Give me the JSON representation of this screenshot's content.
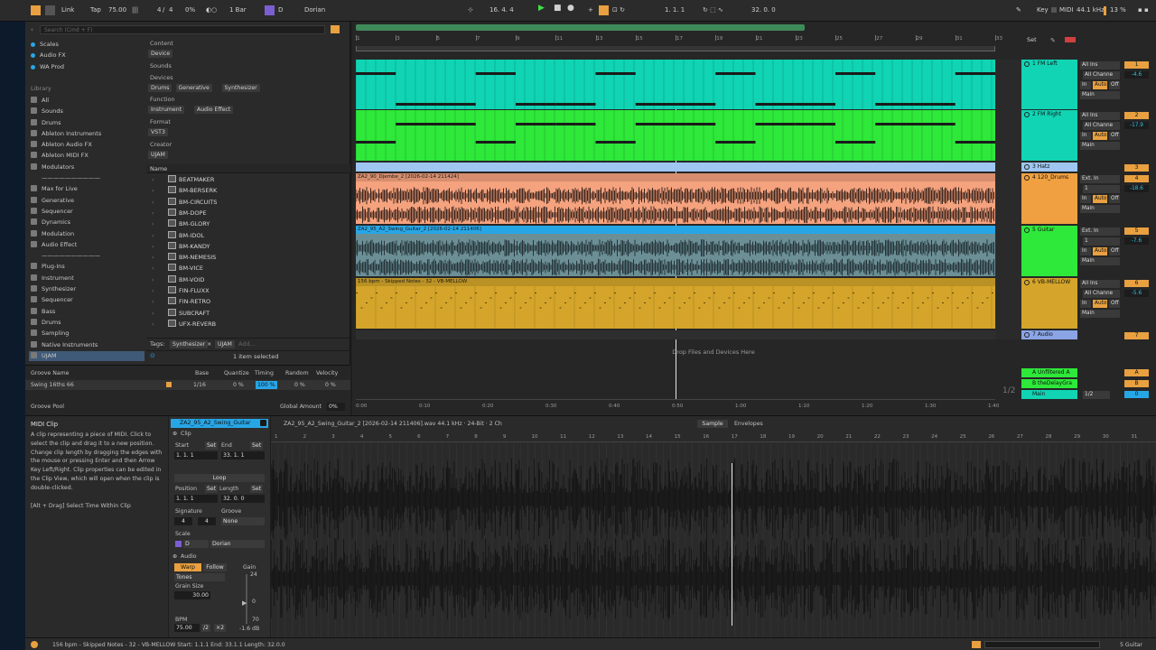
{
  "control": {
    "link": "Link",
    "tap": "Tap",
    "tempo": "75.00",
    "sig_num": "4",
    "sig_den": "4",
    "cpu_pct": "0%",
    "quant": "1 Bar",
    "root": "D",
    "scale": "Dorian",
    "arr_pos": "16.   4.   4",
    "loop_start": "1.   1.   1",
    "loop_len": "32.   0.   0",
    "key_label": "Key",
    "midi_label": "MIDI",
    "sample_rate": "44.1 kHz",
    "cpu": "13 %"
  },
  "browser": {
    "search_placeholder": "Search (Cmd + F)",
    "collections": [
      "Scales",
      "Audio FX",
      "WA Prod"
    ],
    "library_title": "Library",
    "library": [
      "All",
      "Sounds",
      "Drums",
      "Ableton Instruments",
      "Ableton Audio FX",
      "Ableton MIDI FX",
      "Modulators"
    ],
    "sep1": "——————————",
    "library2": [
      "Max for Live",
      "Generative",
      "Sequencer",
      "Dynamics",
      "Modulation",
      "Audio Effect"
    ],
    "sep2": "——————————",
    "library3": [
      "Plug-Ins",
      "Instrument",
      "Synthesizer",
      "Sequencer",
      "Bass",
      "Drums",
      "Sampling",
      "Native Instruments",
      "UJAM"
    ],
    "filters": {
      "content": "Content",
      "content_v": "Device",
      "sounds": "Sounds",
      "devices": "Devices",
      "devices_v": [
        "Drums",
        "Generative",
        "Synthesizer"
      ],
      "function": "Function",
      "function_v": [
        "Instrument",
        "Audio Effect"
      ],
      "format": "Format",
      "format_v": "VST3",
      "creator": "Creator",
      "creator_v": "UJAM"
    },
    "name_header": "Name",
    "presets": [
      "BEATMAKER",
      "BM-BERSERK",
      "BM-CIRCUITS",
      "BM-DOPE",
      "BM-GLORY",
      "BM-IDOL",
      "BM-KANDY",
      "BM-NEMESIS",
      "BM-VICE",
      "BM-VOID",
      "FIN-FLUXX",
      "FIN-RETRO",
      "SUBCRAFT",
      "UFX-REVERB"
    ],
    "tags_label": "Tags:",
    "tag1": "Synthesizer",
    "tag2": "UJAM",
    "tag_add": "Add...",
    "selected": "1 item selected"
  },
  "groove": {
    "h_name": "Groove Name",
    "h_base": "Base",
    "h_quant": "Quantize",
    "h_timing": "Timing",
    "h_random": "Random",
    "h_vel": "Velocity",
    "name": "Swing 16ths 66",
    "base": "1/16",
    "quant": "0 %",
    "timing": "100 %",
    "random": "0 %",
    "vel": "0 %",
    "pool": "Groove Pool",
    "global": "Global Amount",
    "global_v": "0%"
  },
  "ruler": [
    "1",
    "3",
    "5",
    "7",
    "9",
    "11",
    "13",
    "15",
    "17",
    "19",
    "21",
    "23",
    "25",
    "27",
    "29",
    "31",
    "33"
  ],
  "time_ruler": [
    "0:00",
    "0:10",
    "0:20",
    "0:30",
    "0:40",
    "0:50",
    "1:00",
    "1:10",
    "1:20",
    "1:30",
    "1:40"
  ],
  "clips": {
    "c4": "ZA2_90_Djembe_2 [2026-02-14 211424]",
    "c5": "ZA2_95_A2_Swing_Guitar_2 [2026-02-14 211406]",
    "c6": "156 bpm - Skipped Notes - 32 - VB-MELLOW"
  },
  "drop_hint": "Drop Files and Devices Here",
  "zoom": "1/2",
  "set_label": "Set",
  "tracks": [
    {
      "name": "1 FM Left",
      "num": "1",
      "in": "All Ins",
      "ch": "All Channe",
      "vol": "-4.6",
      "mon_in": "In",
      "mon_auto": "Auto",
      "mon_off": "Off",
      "out": "Main"
    },
    {
      "name": "2 FM Right",
      "num": "2",
      "in": "All Ins",
      "ch": "All Channe",
      "vol": "-17.9",
      "mon_in": "In",
      "mon_auto": "Auto",
      "mon_off": "Off",
      "out": "Main"
    },
    {
      "name": "3 Hatz",
      "num": "3"
    },
    {
      "name": "4 120_Drums",
      "num": "4",
      "in": "Ext. In",
      "ch": "1",
      "vol": "-18.6",
      "mon_in": "In",
      "mon_auto": "Auto",
      "mon_off": "Off",
      "out": "Main"
    },
    {
      "name": "5 Guitar",
      "num": "5",
      "in": "Ext. In",
      "ch": "1",
      "vol": "-7.6",
      "mon_in": "In",
      "mon_auto": "Auto",
      "mon_off": "Off",
      "out": "Main"
    },
    {
      "name": "6 VB-MELLOW",
      "num": "6",
      "in": "All Ins",
      "ch": "All Channe",
      "vol": "-5.6",
      "mon_in": "In",
      "mon_auto": "Auto",
      "mon_off": "Off",
      "out": "Main"
    },
    {
      "name": "7 Audio",
      "num": "7"
    }
  ],
  "returns": [
    {
      "name": "A Unfiltered A",
      "num": "A"
    },
    {
      "name": "B theDelayGra",
      "num": "B"
    },
    {
      "name": "Main",
      "num": "0",
      "ch": "1/2"
    }
  ],
  "info": {
    "title": "MIDI Clip",
    "body": "A clip representing a piece of MIDI. Click to select the clip and drag it to a new position. Change clip length by dragging the edges with the mouse or pressing Enter and then Arrow Key Left/Right. Clip properties can be edited in the Clip View, which will open when the clip is double-clicked.",
    "hint": "[Alt + Drag] Select Time Within Clip"
  },
  "clipview": {
    "name": "ZA2_95_A2_Swing_Guitar",
    "section": "Clip",
    "start": "Start",
    "end": "End",
    "set": "Set",
    "start_v": "1.   1.   1",
    "end_v": "33.   1.   1",
    "loop": "Loop",
    "position": "Position",
    "length": "Length",
    "pos_v": "1.   1.   1",
    "len_v": "32.   0.   0",
    "signature": "Signature",
    "groove": "Groove",
    "sig_n": "4",
    "sig_d": "4",
    "groove_v": "None",
    "scale": "Scale",
    "scale_root": "D",
    "scale_mode": "Dorian",
    "audio": "Audio",
    "warp": "Warp",
    "follow": "Follow",
    "gain": "Gain",
    "mode": "Tones",
    "grain": "Grain Size",
    "grain_v": "30.00",
    "bpm": "BPM",
    "bpm_v": "75.00",
    "half": "/2",
    "dbl": "×2",
    "gain_top": "24",
    "gain_mid": "0",
    "gain_bot": "70",
    "gain_v": "-1.6 dB"
  },
  "samplehdr": {
    "file": "ZA2_95_A2_Swing_Guitar_2 [2026-02-14 211406].wav  44.1 kHz · 24-Bit · 2 Ch",
    "tab_sample": "Sample",
    "tab_env": "Envelopes"
  },
  "sample_ruler": [
    "1",
    "2",
    "3",
    "4",
    "5",
    "6",
    "7",
    "8",
    "9",
    "10",
    "11",
    "12",
    "13",
    "14",
    "15",
    "16",
    "17",
    "18",
    "19",
    "20",
    "21",
    "22",
    "23",
    "24",
    "25",
    "26",
    "27",
    "28",
    "29",
    "30",
    "31"
  ],
  "status": {
    "text": "156 bpm - Skipped Notes - 32 - VB-MELLOW  Start: 1.1.1  End: 33.1.1  Length: 32.0.0",
    "track": "5 Guitar"
  },
  "colors": {
    "t1": "#10d4b4",
    "t2": "#2ee83a",
    "t3": "#9ec6f0",
    "t4": "#f5a27e",
    "t5": "#27a6e6",
    "t5wave": "#6c8f96",
    "t6": "#d4a52a",
    "t7": "#8aa4e6",
    "accent": "#f0a040"
  }
}
